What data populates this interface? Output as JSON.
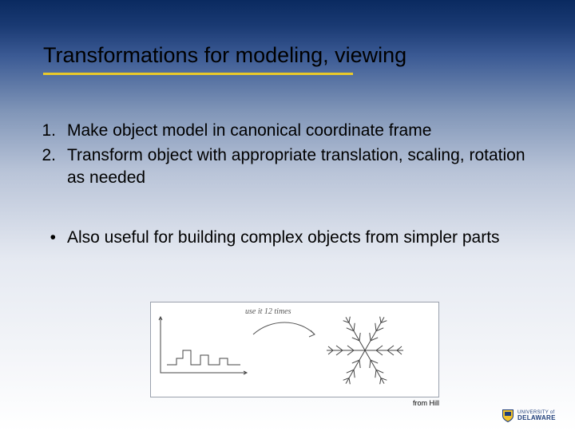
{
  "title": "Transformations for modeling, viewing",
  "list": {
    "n1": {
      "marker": "1.",
      "text": "Make object model in canonical coordinate frame"
    },
    "n2": {
      "marker": "2.",
      "text": "Transform object with appropriate translation, scaling, rotation as needed"
    },
    "b1": {
      "marker": "•",
      "text": "Also useful for building complex objects from simpler parts"
    }
  },
  "figure": {
    "caption": "use it 12 times",
    "credit": "from Hill"
  },
  "logo": {
    "line1": "UNIVERSITY of",
    "line2": "DELAWARE"
  }
}
